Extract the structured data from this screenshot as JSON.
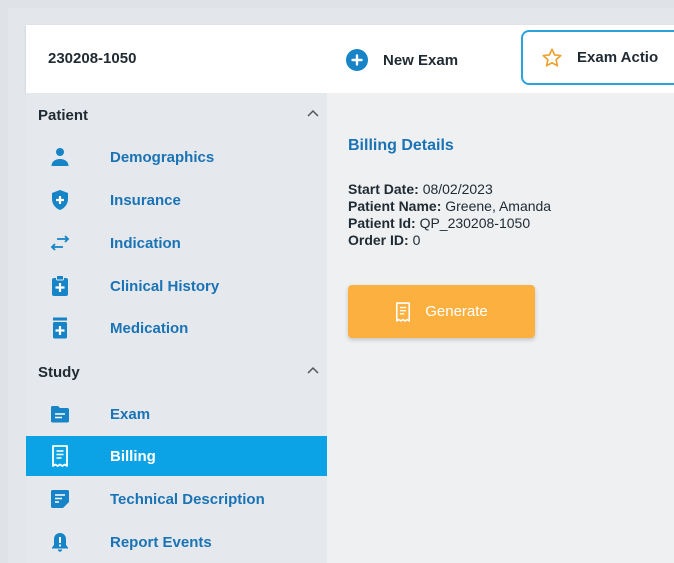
{
  "header": {
    "title": "230208-1050",
    "new_exam_label": "New Exam",
    "exam_actions_label": "Exam Actio"
  },
  "sidebar": {
    "sections": [
      {
        "title": "Patient",
        "items": [
          {
            "label": "Demographics",
            "icon": "person-icon"
          },
          {
            "label": "Insurance",
            "icon": "shield-plus-icon"
          },
          {
            "label": "Indication",
            "icon": "swap-arrows-icon"
          },
          {
            "label": "Clinical History",
            "icon": "clipboard-plus-icon"
          },
          {
            "label": "Medication",
            "icon": "medication-icon"
          }
        ]
      },
      {
        "title": "Study",
        "items": [
          {
            "label": "Exam",
            "icon": "folder-icon"
          },
          {
            "label": "Billing",
            "icon": "receipt-icon",
            "active": true
          },
          {
            "label": "Technical Description",
            "icon": "note-icon"
          },
          {
            "label": "Report Events",
            "icon": "bell-alert-icon"
          }
        ]
      }
    ]
  },
  "main": {
    "title": "Billing Details",
    "details": [
      {
        "label": "Start Date:",
        "value": "08/02/2023"
      },
      {
        "label": "Patient Name:",
        "value": "Greene, Amanda"
      },
      {
        "label": "Patient Id:",
        "value": "QP_230208-1050"
      },
      {
        "label": "Order ID:",
        "value": "0"
      }
    ],
    "generate_label": "Generate"
  },
  "colors": {
    "accent_blue": "#1a73b5",
    "active_bg": "#0ba3e6",
    "generate_bg": "#fbb03f",
    "outline": "#2aa3dd"
  }
}
